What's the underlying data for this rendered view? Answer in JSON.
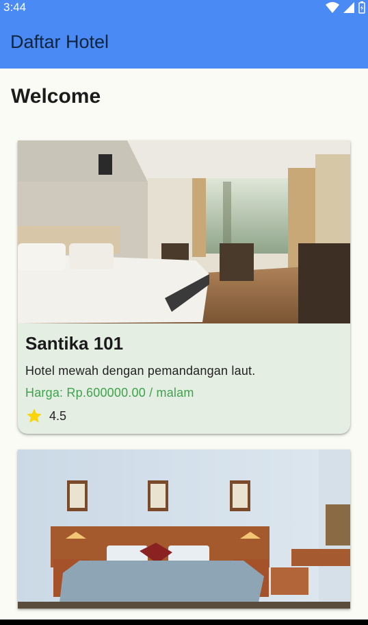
{
  "status_bar": {
    "time": "3:44"
  },
  "app_bar": {
    "title": "Daftar Hotel"
  },
  "welcome": "Welcome",
  "hotels": [
    {
      "name": "Santika 101",
      "description": "Hotel mewah dengan pemandangan laut.",
      "price": "Harga: Rp.600000.00 / malam",
      "rating": "4.5",
      "image": "hotel-room-photo-modern"
    },
    {
      "image": "hotel-room-photo-classic"
    }
  ],
  "colors": {
    "app_bar": "#4a8af4",
    "card": "#e4eee3",
    "price": "#3fa34d",
    "star": "#fbd40a"
  }
}
